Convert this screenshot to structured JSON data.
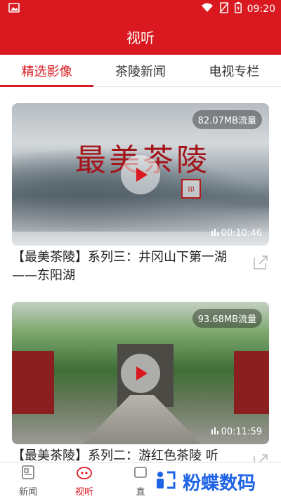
{
  "statusbar": {
    "time": "09:20"
  },
  "appbar": {
    "title": "视听"
  },
  "tabs": [
    {
      "label": "精选影像",
      "active": true
    },
    {
      "label": "茶陵新闻",
      "active": false
    },
    {
      "label": "电视专栏",
      "active": false
    }
  ],
  "videos": [
    {
      "thumbnail_title": "最美茶陵",
      "size": "82.07MB流量",
      "duration": "00:10:46",
      "title": "【最美茶陵】系列三：井冈山下第一湖——东阳湖"
    },
    {
      "size": "93.68MB流量",
      "duration": "00:11:59",
      "title": "【最美茶陵】系列二：游红色茶陵 听"
    }
  ],
  "bottom_nav": [
    {
      "label": "新闻",
      "icon": "news-icon"
    },
    {
      "label": "视听",
      "icon": "video-icon",
      "active": true
    },
    {
      "label": "直",
      "icon": "live-icon"
    }
  ],
  "watermark": {
    "text": "粉蝶数码"
  },
  "colors": {
    "primary": "#d9191f",
    "watermark": "#1e63e6"
  }
}
